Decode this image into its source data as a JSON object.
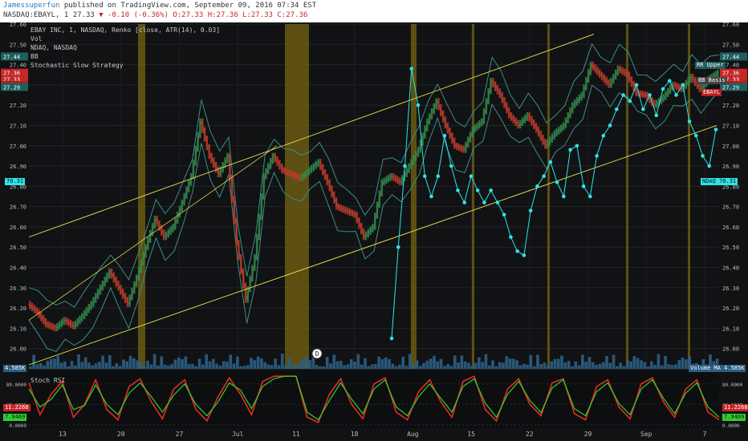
{
  "header": {
    "author": "Jamessuperfun",
    "published": "published on TradingView.com, September 09, 2016 07:34 EST",
    "symbol_line_prefix": "NASDAQ:EBAYL, 1 27.33",
    "change": "▼ -0.10 (-0.36%)",
    "ohlc": "O:27.33 H:27.36 L:27.33 C:27.36"
  },
  "legend": {
    "main": "EBAY INC, 1, NASDAQ, Renko [close, ATR(14), 0.03]",
    "vol": "Vol",
    "ndaq": "NDAQ, NASDAQ",
    "bb": "BB",
    "strategy": "Stochastic Slow Strategy"
  },
  "stoch_legend": "Stoch RSI",
  "markers": {
    "d_marker": "D"
  },
  "tags": {
    "rr_upper": "RR Upper",
    "bb_basis": "BB Basis",
    "ebayl": "EBAYL",
    "ndaq": "NDAQ",
    "ndaq_val": "70.31",
    "volume_ma": "Volume MA",
    "vol_val": "4.585K",
    "left_vol": "4.585K",
    "left_ndaq": "70.31",
    "stoch_val1": "11.2268",
    "stoch_val2": "7.9469"
  },
  "colors": {
    "bg": "#111214",
    "channel": "#d6d64a",
    "highlight": "#6b5a10",
    "ndaq": "#2fe3e6",
    "bb": "#3a8f86",
    "stoch_k": "#e52d20",
    "stoch_d": "#2fd12f",
    "volume": "#2c5f84",
    "renko_up": "#2e8a4c",
    "renko_down": "#c0392b"
  },
  "chart_data": [
    {
      "type": "line",
      "title": "EBAY INC, 1, NASDAQ, Renko [close, ATR(14), 0.03]",
      "x_ticks": [
        "13",
        "20",
        "27",
        "Jul",
        "11",
        "18",
        "Aug",
        "15",
        "22",
        "29",
        "Sep",
        "7"
      ],
      "y_ticks": [
        "27.60",
        "27.50",
        "27.40",
        "27.30",
        "27.20",
        "27.10",
        "27.00",
        "26.90",
        "26.80",
        "26.70",
        "26.60",
        "26.50",
        "26.40",
        "26.30",
        "26.20",
        "26.10",
        "26.00",
        "25.90"
      ],
      "ylim": [
        25.9,
        27.6
      ],
      "price_labels": [
        "27.44",
        "27.36",
        "27.33",
        "27.30",
        "27.29"
      ],
      "series": [
        {
          "name": "EBAYL",
          "values": [
            26.22,
            26.18,
            26.12,
            26.1,
            26.14,
            26.11,
            26.16,
            26.22,
            26.3,
            26.38,
            26.3,
            26.22,
            26.35,
            26.5,
            26.64,
            26.55,
            26.6,
            26.72,
            26.85,
            27.12,
            26.95,
            26.86,
            26.95,
            26.52,
            26.24,
            26.45,
            26.85,
            26.95,
            26.88,
            26.86,
            26.84,
            26.88,
            26.92,
            26.82,
            26.7,
            26.68,
            26.66,
            26.55,
            26.6,
            26.82,
            26.85,
            26.82,
            26.9,
            26.98,
            27.12,
            27.22,
            27.1,
            27.0,
            26.98,
            27.08,
            27.12,
            27.32,
            27.25,
            27.15,
            27.1,
            27.15,
            27.08,
            27.0,
            27.06,
            27.1,
            27.2,
            27.25,
            27.4,
            27.35,
            27.3,
            27.38,
            27.35,
            27.26,
            27.25,
            27.2,
            27.24,
            27.3,
            27.28,
            27.34,
            27.28,
            27.33,
            27.36
          ]
        },
        {
          "name": "NDAQ",
          "values": [
            26.05,
            26.5,
            26.9,
            27.38,
            27.2,
            26.85,
            26.75,
            26.85,
            27.05,
            26.9,
            26.78,
            26.72,
            26.85,
            26.78,
            26.72,
            26.78,
            26.72,
            26.66,
            26.55,
            26.48,
            26.46,
            26.68,
            26.8,
            26.85,
            26.92,
            26.82,
            26.75,
            26.98,
            27.0,
            26.8,
            26.75,
            26.95,
            27.05,
            27.1,
            27.18,
            27.25,
            27.22,
            27.3,
            27.18,
            27.25,
            27.15,
            27.28,
            27.32,
            27.25,
            27.3,
            27.12,
            27.05,
            26.95,
            26.9,
            27.08
          ]
        }
      ]
    },
    {
      "type": "line",
      "title": "Stoch RSI",
      "y_ticks": [
        "80.0000",
        "40.0000",
        "0.0000"
      ],
      "ylim": [
        0,
        100
      ],
      "series": [
        {
          "name": "K",
          "values": [
            82,
            20,
            60,
            85,
            15,
            40,
            88,
            30,
            10,
            75,
            90,
            45,
            12,
            70,
            88,
            30,
            8,
            55,
            92,
            60,
            20,
            85,
            95,
            95,
            95,
            15,
            5,
            60,
            90,
            40,
            12,
            80,
            92,
            25,
            10,
            65,
            88,
            45,
            15,
            85,
            95,
            30,
            8,
            70,
            90,
            40,
            18,
            82,
            90,
            22,
            10,
            75,
            88,
            35,
            12,
            80,
            92,
            45,
            15,
            70,
            88,
            25,
            10
          ]
        },
        {
          "name": "D",
          "values": [
            70,
            35,
            50,
            78,
            30,
            38,
            78,
            40,
            20,
            62,
            82,
            55,
            25,
            58,
            80,
            40,
            18,
            45,
            82,
            68,
            32,
            75,
            90,
            95,
            95,
            25,
            10,
            48,
            82,
            50,
            22,
            70,
            88,
            35,
            18,
            55,
            80,
            52,
            25,
            75,
            90,
            42,
            15,
            60,
            85,
            48,
            24,
            72,
            88,
            32,
            18,
            65,
            82,
            42,
            20,
            70,
            88,
            52,
            22,
            62,
            82,
            35,
            15
          ]
        }
      ]
    }
  ]
}
